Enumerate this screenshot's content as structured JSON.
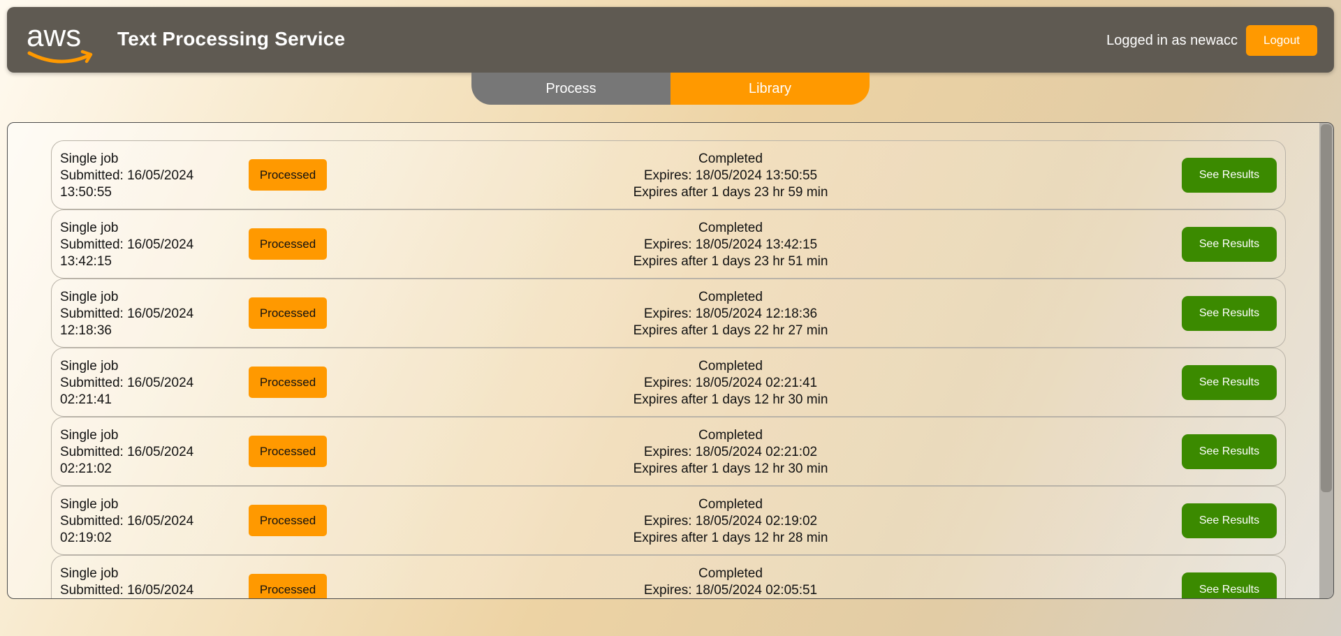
{
  "header": {
    "logo_text": "aws",
    "logo_icon": "aws-logo",
    "title": "Text Processing Service",
    "user_label": "Logged in as newacc",
    "logout_label": "Logout"
  },
  "tabs": [
    {
      "label": "Process",
      "active": false
    },
    {
      "label": "Library",
      "active": true
    }
  ],
  "colors": {
    "accent": "#ff9900",
    "header_bg": "#5f5a52",
    "inactive_tab": "#777777",
    "results_button": "#3b8a00"
  },
  "jobs": [
    {
      "type": "Single job",
      "submitted": "Submitted: 16/05/2024",
      "time": "13:50:55",
      "badge": "Processed",
      "status": "Completed",
      "expires": "Expires: 18/05/2024 13:50:55",
      "remaining": "Expires after 1 days 23 hr 59 min",
      "action": "See Results"
    },
    {
      "type": "Single job",
      "submitted": "Submitted: 16/05/2024",
      "time": "13:42:15",
      "badge": "Processed",
      "status": "Completed",
      "expires": "Expires: 18/05/2024 13:42:15",
      "remaining": "Expires after 1 days 23 hr 51 min",
      "action": "See Results"
    },
    {
      "type": "Single job",
      "submitted": "Submitted: 16/05/2024",
      "time": "12:18:36",
      "badge": "Processed",
      "status": "Completed",
      "expires": "Expires: 18/05/2024 12:18:36",
      "remaining": "Expires after 1 days 22 hr 27 min",
      "action": "See Results"
    },
    {
      "type": "Single job",
      "submitted": "Submitted: 16/05/2024",
      "time": "02:21:41",
      "badge": "Processed",
      "status": "Completed",
      "expires": "Expires: 18/05/2024 02:21:41",
      "remaining": "Expires after 1 days 12 hr 30 min",
      "action": "See Results"
    },
    {
      "type": "Single job",
      "submitted": "Submitted: 16/05/2024",
      "time": "02:21:02",
      "badge": "Processed",
      "status": "Completed",
      "expires": "Expires: 18/05/2024 02:21:02",
      "remaining": "Expires after 1 days 12 hr 30 min",
      "action": "See Results"
    },
    {
      "type": "Single job",
      "submitted": "Submitted: 16/05/2024",
      "time": "02:19:02",
      "badge": "Processed",
      "status": "Completed",
      "expires": "Expires: 18/05/2024 02:19:02",
      "remaining": "Expires after 1 days 12 hr 28 min",
      "action": "See Results"
    },
    {
      "type": "Single job",
      "submitted": "Submitted: 16/05/2024",
      "time": "",
      "badge": "Processed",
      "status": "Completed",
      "expires": "Expires: 18/05/2024 02:05:51",
      "remaining": "",
      "action": "See Results"
    }
  ]
}
